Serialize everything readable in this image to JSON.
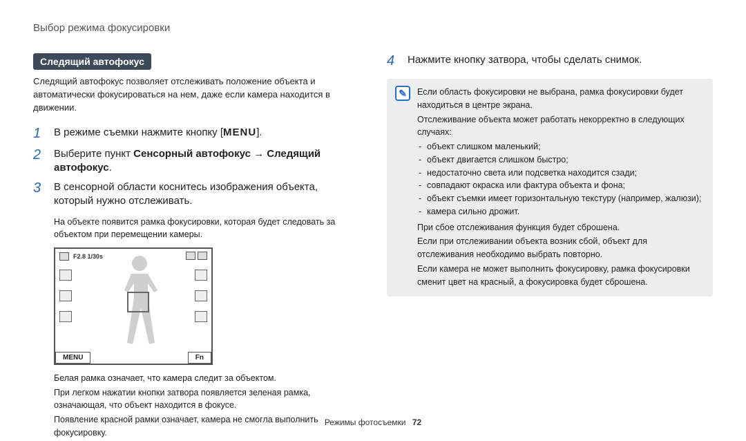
{
  "page": {
    "title": "Выбор режима фокусировки",
    "footer_section": "Режимы фотосъемки",
    "page_number": "72"
  },
  "left": {
    "badge": "Следящий автофокус",
    "intro": "Следящий автофокус позволяет отслеживать положение объекта и автоматически фокусироваться на нем, даже если камера находится в движении.",
    "steps": {
      "s1n": "1",
      "s1a": "В режиме съемки нажмите кнопку [",
      "s1menu": "MENU",
      "s1b": "].",
      "s2n": "2",
      "s2a": "Выберите пункт ",
      "s2b1": "Сенсорный автофокус",
      "s2arrow": " → ",
      "s2b2": "Следящий автофокус",
      "s2c": ".",
      "s3n": "3",
      "s3": "В сенсорной области коснитесь изображения объекта, который нужно отслеживать.",
      "s3sub": "На объекте появится рамка фокусировки, которая будет следовать за объектом при перемещении камеры."
    },
    "camera": {
      "exposure": "F2.8 1/30s",
      "btn_menu": "MENU",
      "btn_fn": "Fn"
    },
    "notes": {
      "n1": "Белая рамка означает, что камера следит за объектом.",
      "n2": "При легком нажатии кнопки затвора появляется зеленая рамка, означающая, что объект находится в фокусе.",
      "n3": "Появление красной рамки означает, камера не смогла выполнить фокусировку."
    }
  },
  "right": {
    "step4n": "4",
    "step4": "Нажмите кнопку затвора, чтобы сделать снимок.",
    "info": {
      "p1": "Если область фокусировки не выбрана, рамка фокусировки будет находиться в центре экрана.",
      "p2": "Отслеживание объекта может работать некорректно в следующих случаях:",
      "li1": "объект слишком маленький;",
      "li2": "объект двигается слишком быстро;",
      "li3": "недостаточно света или подсветка находится сзади;",
      "li4": "совпадают окраска или фактура объекта и фона;",
      "li5": "объект съемки имеет горизонтальную текстуру (например, жалюзи);",
      "li6": "камера сильно дрожит.",
      "p3": "При сбое отслеживания функция будет сброшена.",
      "p4": "Если при отслеживании объекта возник сбой, объект для отслеживания необходимо выбрать повторно.",
      "p5": "Если камера не может выполнить фокусировку, рамка фокусировки сменит цвет на красный, а фокусировка будет сброшена."
    }
  }
}
